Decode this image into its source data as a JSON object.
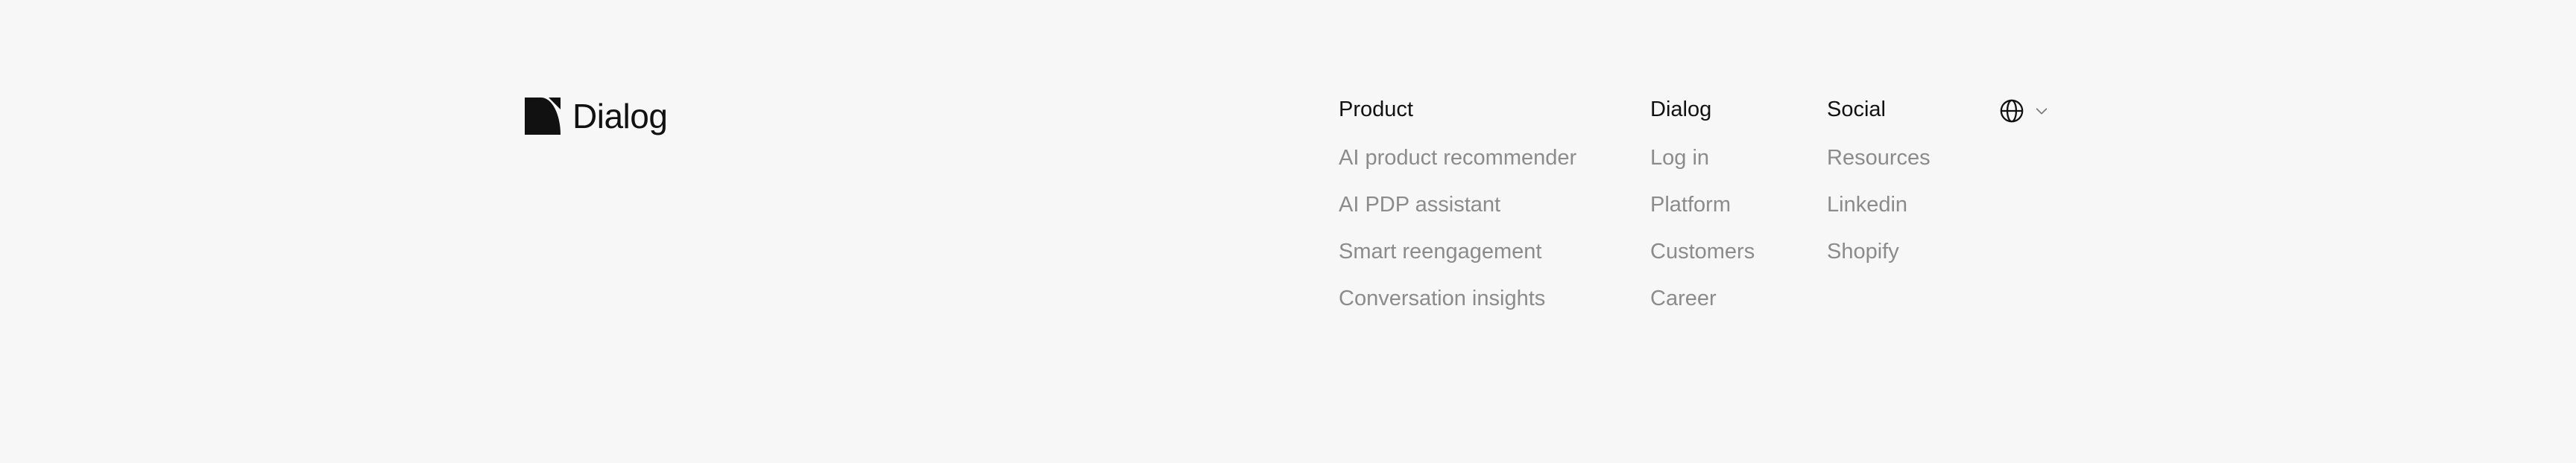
{
  "brand": {
    "name": "Dialog",
    "icon": "dialog-logo-icon"
  },
  "columns": [
    {
      "id": "product",
      "title": "Product",
      "links": [
        "AI product recommender",
        "AI PDP assistant",
        "Smart reengagement",
        "Conversation insights"
      ]
    },
    {
      "id": "dialog",
      "title": "Dialog",
      "links": [
        "Log in",
        "Platform",
        "Customers",
        "Career"
      ]
    },
    {
      "id": "social",
      "title": "Social",
      "links": [
        "Resources",
        "Linkedin",
        "Shopify"
      ]
    }
  ],
  "language_selector": {
    "icon": "globe-icon",
    "caret": "chevron-down-icon"
  },
  "colors": {
    "background": "#f7f7f7",
    "heading": "#111111",
    "link": "#8b8b8b"
  }
}
